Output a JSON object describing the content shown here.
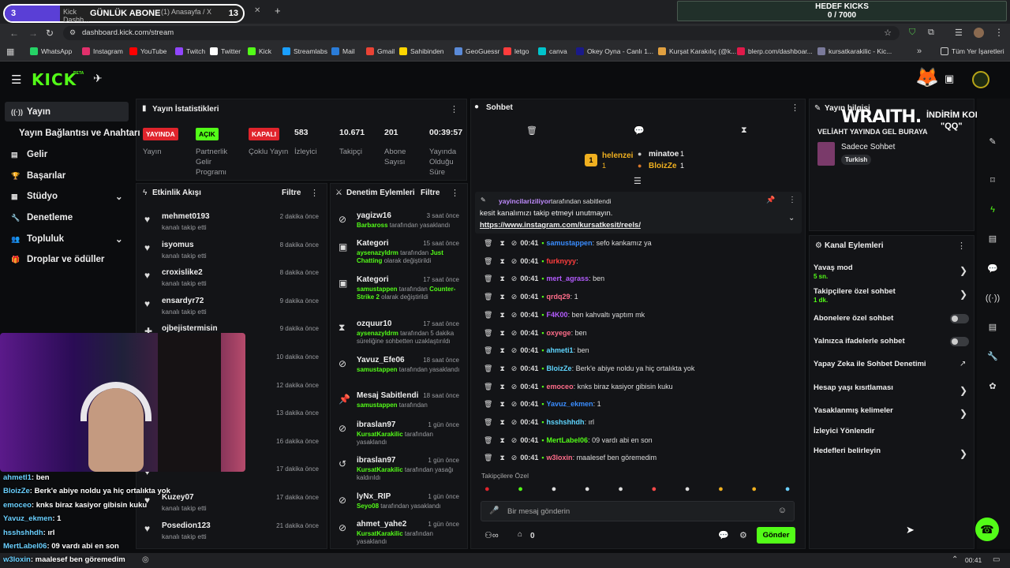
{
  "browser": {
    "counter_left": "3",
    "goal_overlay": "GÜNLÜK ABONE",
    "counter_right": "13",
    "tab1": "Kick Dashb...",
    "tab2": "(1) Anasayfa / X",
    "url": "dashboard.kick.com/stream"
  },
  "bookmarks": [
    "WhatsApp",
    "Instagram",
    "YouTube",
    "Twitch",
    "Twitter",
    "Kick",
    "Streamlabs",
    "Mail",
    "Gmail",
    "Sahibinden",
    "GeoGuessr",
    "letgo",
    "canva",
    "Okey Oyna - Canlı 1...",
    "Kurşat Karakılıç (@k...",
    "blerp.com/dashboar...",
    "kursatkarakilic - Kic..."
  ],
  "bookmarks_all": "Tüm Yer İşaretleri",
  "hedef": {
    "title": "HEDEF KICKS",
    "value": "0 / 7000"
  },
  "kick": {
    "logo": "KICK",
    "beta": "BETA"
  },
  "sidebar": [
    {
      "icon": "((·))",
      "label": "Yayın"
    },
    {
      "icon": "",
      "label": "Yayın Bağlantısı ve Anahtarı"
    },
    {
      "icon": "▤",
      "label": "Gelir"
    },
    {
      "icon": "🏆",
      "label": "Başarılar"
    },
    {
      "icon": "▦",
      "label": "Stüdyo"
    },
    {
      "icon": "🔧",
      "label": "Denetleme"
    },
    {
      "icon": "👥",
      "label": "Topluluk"
    },
    {
      "icon": "🎁",
      "label": "Droplar ve ödüller"
    }
  ],
  "stats": {
    "title": "Yayın İstatistikleri",
    "items": [
      {
        "badge": "YAYINDA",
        "label": "Yayın"
      },
      {
        "badge": "AÇIK",
        "label": "Partnerlik Gelir Programı"
      },
      {
        "badge": "KAPALI",
        "label": "Çoklu Yayın"
      },
      {
        "value": "583",
        "label": "İzleyici"
      },
      {
        "value": "10.671",
        "label": "Takipçi"
      },
      {
        "value": "201",
        "label": "Abone Sayısı"
      },
      {
        "value": "00:39:57",
        "label": "Yayında Olduğu Süre"
      }
    ]
  },
  "activity": {
    "title": "Etkinlik Akışı",
    "filter": "Filtre",
    "items": [
      {
        "name": "mehmet0193",
        "sub": "kanalı takip etti",
        "time": "2 dakika önce"
      },
      {
        "name": "isyomus",
        "sub": "kanalı takip etti",
        "time": "8 dakika önce"
      },
      {
        "name": "croxislike2",
        "sub": "kanalı takip etti",
        "time": "8 dakika önce"
      },
      {
        "name": "ensardyr72",
        "sub": "kanalı takip etti",
        "time": "9 dakika önce"
      },
      {
        "name": "ojbejistermisin",
        "sub": "5 abonelik hediye etti.",
        "time": "9 dakika önce"
      },
      {
        "name": "",
        "sub": "",
        "time": "10 dakika önce"
      },
      {
        "name": "",
        "sub": "",
        "time": "12 dakika önce"
      },
      {
        "name": "",
        "sub": "",
        "time": "13 dakika önce"
      },
      {
        "name": "",
        "sub": "",
        "time": "16 dakika önce"
      },
      {
        "name": "",
        "sub": "",
        "time": "17 dakika önce"
      },
      {
        "name": "Kuzey07",
        "sub": "kanalı takip etti",
        "time": "17 dakika önce"
      },
      {
        "name": "Posedion123",
        "sub": "kanalı takip etti",
        "time": "21 dakika önce"
      }
    ]
  },
  "modlog": {
    "title": "Denetim Eylemleri",
    "filter": "Filtre",
    "items": [
      {
        "name": "yagizw16",
        "time": "3 saat önce",
        "actor": "Barbaross",
        "rest": " tarafından yasaklandı"
      },
      {
        "name": "Kategori",
        "time": "15 saat önce",
        "actor": "aysenazyldrm",
        "rest": " tarafından ",
        "extra": "Just Chatting",
        "rest2": " olarak değiştirildi"
      },
      {
        "name": "Kategori",
        "time": "17 saat önce",
        "actor": "samustappen",
        "rest": " tarafından ",
        "extra": "Counter-Strike 2",
        "rest2": " olarak değiştirildi"
      },
      {
        "name": "ozquur10",
        "time": "17 saat önce",
        "actor": "aysenazyldrm",
        "rest": " tarafından 5 dakika süreliğine sohbetten uzaklaştırıldı"
      },
      {
        "name": "Yavuz_Efe06",
        "time": "18 saat önce",
        "actor": "samustappen",
        "rest": " tarafından yasaklandı"
      },
      {
        "name": "Mesaj Sabitlendi",
        "time": "18 saat önce",
        "actor": "samustappen",
        "rest": " tarafından"
      },
      {
        "name": "ibraslan97",
        "time": "1 gün önce",
        "actor": "KursatKarakilic",
        "rest": " tarafından yasaklandı"
      },
      {
        "name": "ibraslan97",
        "time": "1 gün önce",
        "actor": "KursatKarakilic",
        "rest": " tarafından yasağı kaldırıldı"
      },
      {
        "name": "lyNx_RIP",
        "time": "1 gün önce",
        "actor": "Seyo08",
        "rest": " tarafından yasaklandı"
      },
      {
        "name": "ahmet_yahe2",
        "time": "1 gün önce",
        "actor": "KursatKarakilic",
        "rest": " tarafından yasaklandı"
      }
    ]
  },
  "chat": {
    "title": "Sohbet",
    "top": [
      {
        "name": "helenzei",
        "count": "1"
      },
      {
        "name": "minatoe",
        "count": "1"
      },
      {
        "name": "BloizZe",
        "count": "1"
      }
    ],
    "pinned_by": "yayincilariziliyor",
    "pinned_suffix": "tarafından sabitlendi",
    "pinned_text": "kesit kanalımızı takip etmeyi unutmayın.",
    "pinned_link": "https://www.instagram.com/kursatkesit/reels/",
    "messages": [
      {
        "time": "00:41",
        "user": "samustappen",
        "color": "#3a8dff",
        "text": ": sefo kankamız ya"
      },
      {
        "time": "00:41",
        "user": "furknyyy",
        "color": "#ff3d3d",
        "text": ":"
      },
      {
        "time": "00:41",
        "user": "mert_agrass",
        "color": "#b45cff",
        "text": ": ben"
      },
      {
        "time": "00:41",
        "user": "qrdq29",
        "color": "#ff6d8a",
        "text": ": 1"
      },
      {
        "time": "00:41",
        "user": "F4K00",
        "color": "#b45cff",
        "text": ": ben kahvaltı yaptım mk"
      },
      {
        "time": "00:41",
        "user": "oxyege",
        "color": "#ff6d8a",
        "text": ": ben"
      },
      {
        "time": "00:41",
        "user": "ahmeti1",
        "color": "#5fd6ff",
        "text": ": ben"
      },
      {
        "time": "00:41",
        "user": "BloizZe",
        "color": "#5fd6ff",
        "text": ": Berk'e abiye noldu ya hiç ortalıkta yok"
      },
      {
        "time": "00:41",
        "user": "emoceo",
        "color": "#ff6d8a",
        "text": ": knks biraz kasiyor gibisin kuku"
      },
      {
        "time": "00:41",
        "user": "Yavuz_ekmen",
        "color": "#3a8dff",
        "text": ": 1"
      },
      {
        "time": "00:41",
        "user": "hsshshhdh",
        "color": "#5fd6ff",
        "text": ": ırl"
      },
      {
        "time": "00:41",
        "user": "MertLabel06",
        "color": "#53fc18",
        "text": ": 09 vardı abi en son"
      },
      {
        "time": "00:41",
        "user": "w3loxin",
        "color": "#ff6d8a",
        "text": ": maalesef ben göremedim"
      }
    ],
    "followers_only": "Takipçilere Özel",
    "input_placeholder": "Bir mesaj gönderin",
    "send": "Gönder",
    "viewers_count": "0"
  },
  "streaminfo": {
    "title": "Yayın bilgisi",
    "overlay_brand": "WRAITH.",
    "overlay_code": "İNDİRİM KODU:",
    "overlay_code2": "\"QQ\"",
    "headline": "VELİAHT YAYINDA GEL BURAYA",
    "category": "Sadece Sohbet",
    "tag": "Turkish"
  },
  "channel": {
    "title": "Kanal Eylemleri",
    "items": [
      {
        "label": "Yavaş mod",
        "sub": "5 sn.",
        "ctrl": "chev"
      },
      {
        "label": "Takipçilere özel sohbet",
        "sub": "1 dk.",
        "ctrl": "chev"
      },
      {
        "label": "Abonelere özel sohbet",
        "ctrl": "toggle"
      },
      {
        "label": "Yalnızca ifadelerle sohbet",
        "ctrl": "toggle"
      },
      {
        "label": "Yapay Zeka ile Sohbet Denetimi",
        "ctrl": "ext"
      },
      {
        "label": "Hesap yaşı kısıtlaması",
        "ctrl": "chev"
      },
      {
        "label": "Yasaklanmış kelimeler",
        "ctrl": "chev"
      },
      {
        "label": "İzleyici Yönlendir",
        "ctrl": ""
      },
      {
        "label": "Hedefleri belirleyin",
        "ctrl": "chev"
      }
    ]
  },
  "overlay_chat": [
    {
      "user": "ahmetl1",
      "text": ": ben"
    },
    {
      "user": "BloizZe",
      "text": ": Berk'e abiye noldu ya hiç ortalıkta yok"
    },
    {
      "user": "emoceo",
      "text": ": knks biraz kasiyor gibisin kuku"
    },
    {
      "user": "Yavuz_ekmen",
      "text": ": 1"
    },
    {
      "user": "hsshshhdh",
      "text": ": ırl"
    },
    {
      "user": "MertLabel06",
      "text": ": 09 vardı abi en son"
    },
    {
      "user": "w3loxin",
      "text": ": maalesef ben göremedim"
    }
  ],
  "taskbar_time": "00:41",
  "colors": {
    "kick_green": "#53fc18",
    "red_badge": "#e0242c",
    "panel_bg": "#131417"
  }
}
